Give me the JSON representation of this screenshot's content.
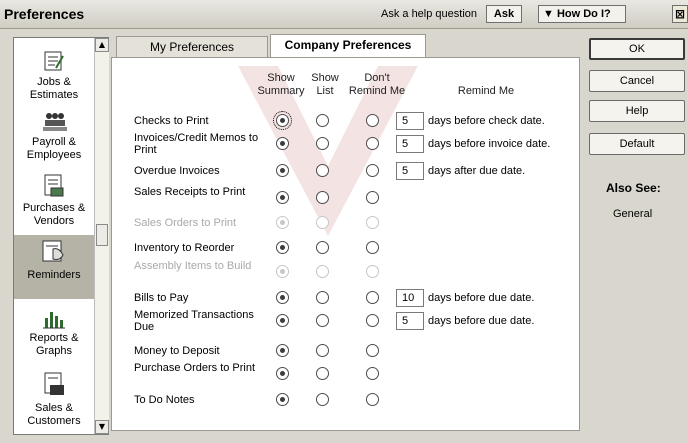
{
  "window": {
    "title": "Preferences",
    "help_prompt": "Ask a help question",
    "ask_label": "Ask",
    "how_do_i_label": "How Do I?",
    "close_glyph": "⊠"
  },
  "sidebar": {
    "items": [
      {
        "label": "Jobs & Estimates",
        "icon": "jobs-estimates-icon"
      },
      {
        "label": "Payroll & Employees",
        "icon": "payroll-employees-icon"
      },
      {
        "label": "Purchases & Vendors",
        "icon": "purchases-vendors-icon"
      },
      {
        "label": "Reminders",
        "icon": "reminders-icon",
        "selected": true
      },
      {
        "label": "Reports & Graphs",
        "icon": "reports-graphs-icon"
      },
      {
        "label": "Sales & Customers",
        "icon": "sales-customers-icon"
      }
    ]
  },
  "tabs": [
    {
      "label": "My Preferences",
      "active": false
    },
    {
      "label": "Company Preferences",
      "active": true
    }
  ],
  "columns": {
    "show_summary": "Show Summary",
    "show_list": "Show List",
    "dont_remind": "Don't Remind Me",
    "remind_me": "Remind Me"
  },
  "reminders": [
    {
      "label": "Checks to Print",
      "selected": "summary",
      "disabled": false,
      "days": "5",
      "days_text": "days before check date."
    },
    {
      "label": "Invoices/Credit Memos to Print",
      "selected": "summary",
      "disabled": false,
      "days": "5",
      "days_text": "days before invoice date."
    },
    {
      "label": "Overdue Invoices",
      "selected": "summary",
      "disabled": false,
      "days": "5",
      "days_text": "days after due date."
    },
    {
      "label": "Sales Receipts to Print",
      "selected": "summary",
      "disabled": false
    },
    {
      "label": "Sales Orders to Print",
      "selected": "summary",
      "disabled": true
    },
    {
      "label": "Inventory to Reorder",
      "selected": "summary",
      "disabled": false
    },
    {
      "label": "Assembly Items to Build",
      "selected": "summary",
      "disabled": true
    },
    {
      "label": "Bills to Pay",
      "selected": "summary",
      "disabled": false,
      "days": "10",
      "days_text": "days before due date."
    },
    {
      "label": "Memorized Transactions Due",
      "selected": "summary",
      "disabled": false,
      "days": "5",
      "days_text": "days before due date."
    },
    {
      "label": "Money to Deposit",
      "selected": "summary",
      "disabled": false
    },
    {
      "label": "Purchase Orders to Print",
      "selected": "summary",
      "disabled": false
    },
    {
      "label": "To Do Notes",
      "selected": "summary",
      "disabled": false
    }
  ],
  "buttons": {
    "ok": "OK",
    "cancel": "Cancel",
    "help": "Help",
    "default": "Default"
  },
  "also_see": {
    "heading": "Also See:",
    "link": "General"
  }
}
